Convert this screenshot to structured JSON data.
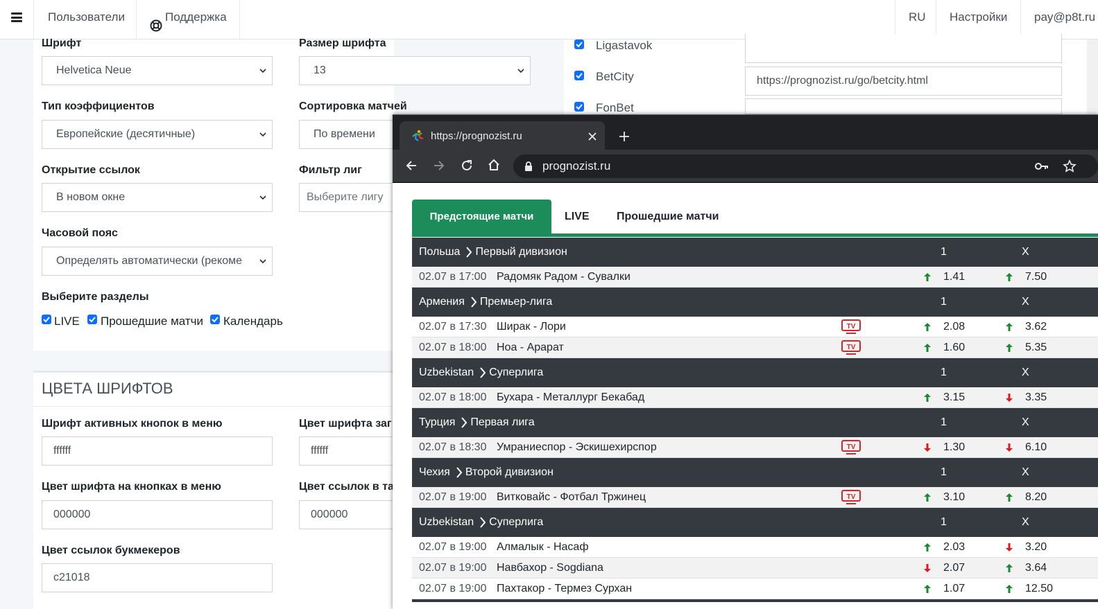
{
  "navbar": {
    "users_label": "Пользователи",
    "support_label": "Поддержка",
    "lang_label": "RU",
    "settings_label": "Настройки",
    "account_label": "pay@p8t.ru"
  },
  "settings": {
    "font_label": "Шрифт",
    "font_value": "Helvetica Neue",
    "font_size_label": "Размер шрифта",
    "font_size_value": "13",
    "odds_type_label": "Тип коэффициентов",
    "odds_type_value": "Европейские (десятичные)",
    "sort_label": "Сортировка матчей",
    "sort_value": "По времени",
    "links_label": "Открытие ссылок",
    "links_value": "В новом окне",
    "league_filter_label": "Фильтр лиг",
    "league_filter_placeholder": "Выберите лигу",
    "timezone_label": "Часовой пояс",
    "timezone_value": "Определять автоматически (рекоме",
    "sections_label": "Выберите разделы",
    "sections": [
      {
        "label": "LIVE",
        "checked": true
      },
      {
        "label": "Прошедшие матчи",
        "checked": true
      },
      {
        "label": "Календарь",
        "checked": true
      }
    ]
  },
  "colors": {
    "section_title": "ЦВЕТА ШРИФТОВ",
    "active_btn_label": "Шрифт активных кнопок в меню",
    "active_btn_value": "ffffff",
    "header_font_label": "Цвет шрифта заг",
    "header_font_value": "ffffff",
    "menu_btn_label": "Цвет шрифта на кнопках в меню",
    "menu_btn_value": "000000",
    "table_links_label": "Цвет ссылок в та",
    "table_links_value": "000000",
    "bk_links_label": "Цвет ссылок букмекеров",
    "bk_links_value": "c21018"
  },
  "bookmakers": [
    {
      "name": "Ligastavok",
      "checked": true,
      "url": ""
    },
    {
      "name": "BetCity",
      "checked": true,
      "url": "https://prognozist.ru/go/betcity.html"
    },
    {
      "name": "FonBet",
      "checked": true,
      "url": ""
    }
  ],
  "browser": {
    "tab_title": "https://prognozist.ru",
    "address": "prognozist.ru"
  },
  "widget": {
    "tabs": [
      "Предстоящие матчи",
      "LIVE",
      "Прошедшие матчи"
    ],
    "col_1": "1",
    "col_x": "X",
    "leagues": [
      {
        "country": "Польша",
        "league": "Первый дивизион",
        "matches": [
          {
            "time": "02.07 в 17:00",
            "teams": "Радомяк Радом - Сувалки",
            "tv": false,
            "odd1": "1.41",
            "dir1": "up",
            "oddx": "7.50",
            "dirx": "up"
          }
        ]
      },
      {
        "country": "Армения",
        "league": "Премьер-лига",
        "matches": [
          {
            "time": "02.07 в 17:30",
            "teams": "Ширак - Лори",
            "tv": true,
            "odd1": "2.08",
            "dir1": "up",
            "oddx": "3.62",
            "dirx": "up"
          },
          {
            "time": "02.07 в 18:00",
            "teams": "Ноа - Арарат",
            "tv": true,
            "odd1": "1.60",
            "dir1": "up",
            "oddx": "5.35",
            "dirx": "up"
          }
        ]
      },
      {
        "country": "Uzbekistan",
        "league": "Суперлига",
        "matches": [
          {
            "time": "02.07 в 18:00",
            "teams": "Бухара - Металлург Бекабад",
            "tv": false,
            "odd1": "3.15",
            "dir1": "up",
            "oddx": "3.35",
            "dirx": "down"
          }
        ]
      },
      {
        "country": "Турция",
        "league": "Первая лига",
        "matches": [
          {
            "time": "02.07 в 18:30",
            "teams": "Умраниеспор - Эскишехирспор",
            "tv": true,
            "odd1": "1.30",
            "dir1": "down",
            "oddx": "6.10",
            "dirx": "down"
          }
        ]
      },
      {
        "country": "Чехия",
        "league": "Второй дивизион",
        "matches": [
          {
            "time": "02.07 в 19:00",
            "teams": "Витковайс - Фотбал Тржинец",
            "tv": true,
            "odd1": "3.10",
            "dir1": "up",
            "oddx": "8.20",
            "dirx": "up"
          }
        ]
      },
      {
        "country": "Uzbekistan",
        "league": "Суперлига",
        "matches": [
          {
            "time": "02.07 в 19:00",
            "teams": "Алмалык - Насаф",
            "tv": false,
            "odd1": "2.03",
            "dir1": "up",
            "oddx": "3.20",
            "dirx": "down"
          },
          {
            "time": "02.07 в 19:00",
            "teams": "Навбахор - Sogdiana",
            "tv": false,
            "odd1": "2.07",
            "dir1": "down",
            "oddx": "3.64",
            "dirx": "up"
          },
          {
            "time": "02.07 в 19:00",
            "teams": "Пахтакор - Термез Сурхан",
            "tv": false,
            "odd1": "1.07",
            "dir1": "up",
            "oddx": "12.50",
            "dirx": "up"
          }
        ]
      }
    ]
  },
  "theme": {
    "accent": "#1b8c5a",
    "header_bg": "#343a40",
    "arrow_up": "#1a8a2e",
    "arrow_down": "#e0191f",
    "tv_red": "#d9262c",
    "checkbox_blue": "#0d6efd"
  }
}
